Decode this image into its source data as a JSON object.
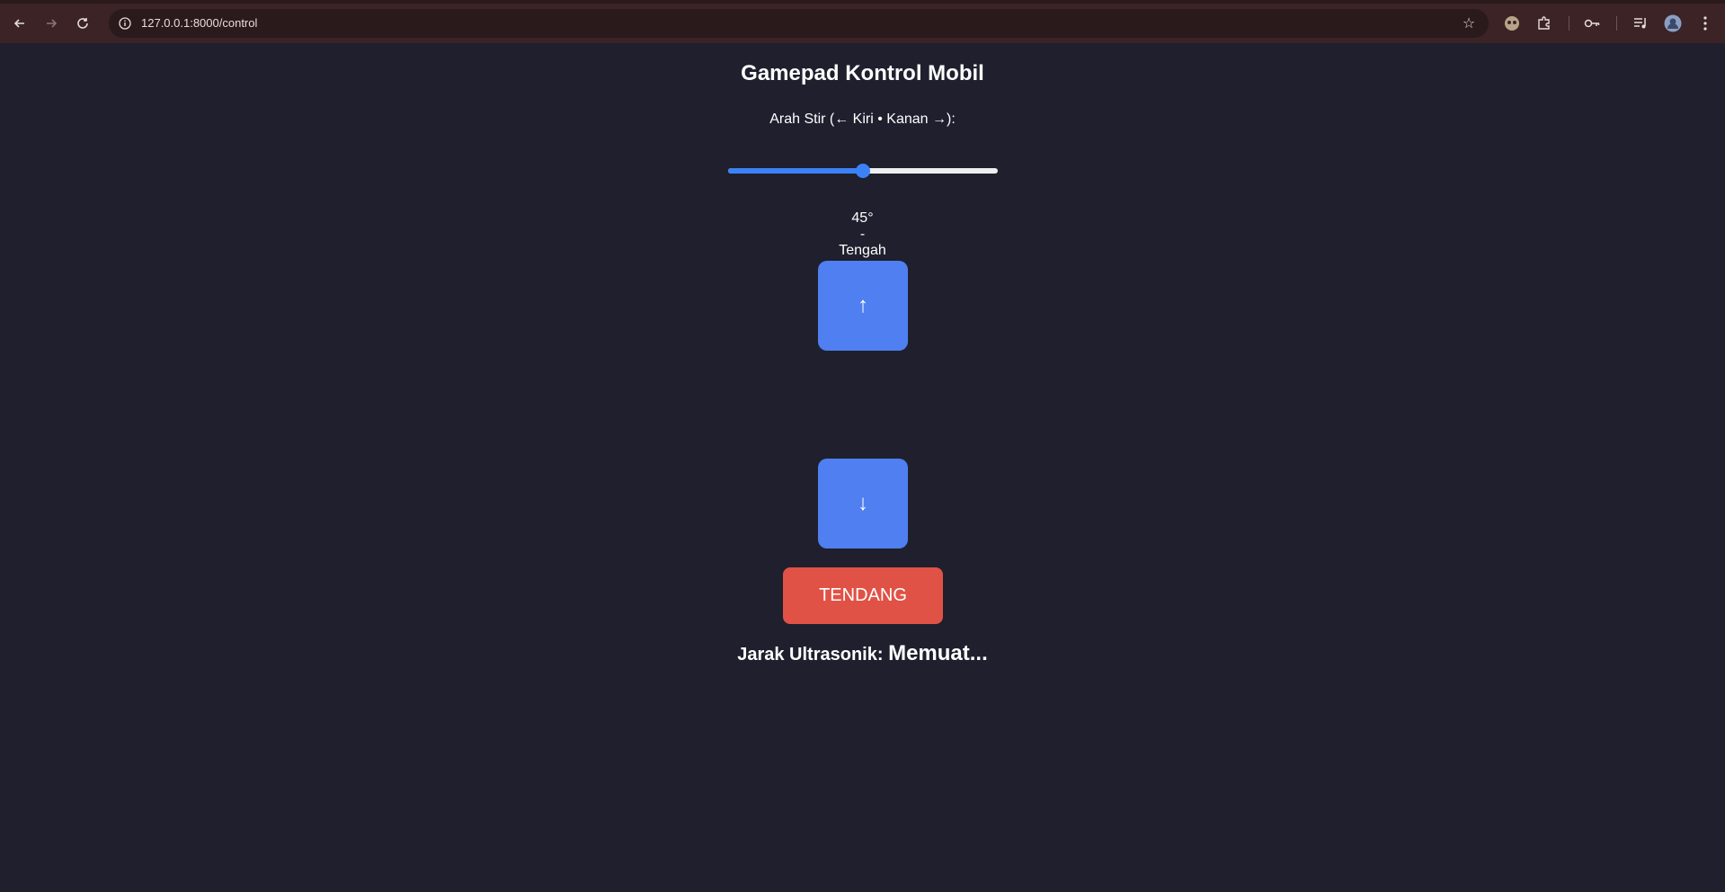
{
  "browser": {
    "url": "127.0.0.1:8000/control"
  },
  "page": {
    "title": "Gamepad Kontrol Mobil",
    "steer_label": "Arah Stir (← Kiri • Kanan →):",
    "steer_fraction": 0.5,
    "angle": {
      "value": "45°",
      "separator": "-",
      "direction": "Tengah"
    },
    "up_button": "↑",
    "down_button": "↓",
    "kick_button": "TENDANG",
    "distance": {
      "label": "Jarak Ultrasonik:",
      "value": "Memuat..."
    }
  },
  "colors": {
    "background": "#1f1f2e",
    "accent_blue": "#4f7ff0",
    "kick_red": "#e05245",
    "browser_chrome": "#3b2326"
  }
}
